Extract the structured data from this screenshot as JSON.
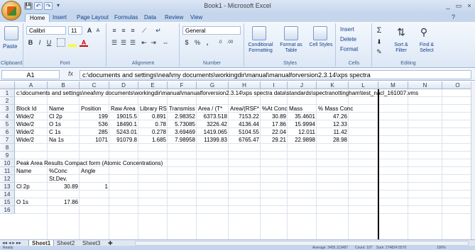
{
  "window": {
    "title": "Book1 - Microsoft Excel",
    "controls": [
      "_",
      "▭",
      "×"
    ]
  },
  "quick_access": [
    "💾",
    "↶",
    "↷",
    "▾"
  ],
  "tabs": [
    "Home",
    "Insert",
    "Page Layout",
    "Formulas",
    "Data",
    "Review",
    "View"
  ],
  "active_tab": "Home",
  "ribbon": {
    "clipboard": {
      "label": "Clipboard",
      "paste": "Paste"
    },
    "font": {
      "label": "Font",
      "family": "Calibri",
      "size": "11",
      "bold": "B",
      "italic": "I",
      "underline": "U",
      "grow": "A",
      "shrink": "A"
    },
    "alignment": {
      "label": "Alignment"
    },
    "number": {
      "label": "Number",
      "format": "General",
      "currency": "$",
      "percent": "%",
      "comma": ","
    },
    "styles": {
      "label": "Styles",
      "conditional": "Conditional Formatting",
      "format_table": "Format as Table",
      "cell_styles": "Cell Styles"
    },
    "cells": {
      "label": "Cells",
      "insert": "Insert",
      "delete": "Delete",
      "format": "Format"
    },
    "editing": {
      "label": "Editing",
      "sum": "Σ",
      "sort": "Sort & Filter",
      "find": "Find & Select"
    }
  },
  "formula_bar": {
    "name_box": "A1",
    "fx": "fx",
    "formula": "c:\\documents and settings\\neal\\my documents\\workingdir\\manual\\manualforversion2.3.14\\xps spectra"
  },
  "columns": [
    "A",
    "B",
    "C",
    "D",
    "E",
    "F",
    "G",
    "H",
    "I",
    "J",
    "K",
    "L",
    "M",
    "N",
    "O",
    "P"
  ],
  "rows": [
    "1",
    "2",
    "3",
    "4",
    "5",
    "6",
    "7",
    "8",
    "9",
    "10",
    "11",
    "12",
    "13",
    "14",
    "15",
    "16"
  ],
  "cells": {
    "r1": "c:\\documents and settings\\neal\\my documents\\workingdir\\manual\\manualforversion2.3.14\\xps spectra data\\standards\\spectranottingham\\test_nacl_161007.vms",
    "r3": [
      "Block Id",
      "Name",
      "Position",
      "Raw Area",
      "Library RS",
      "Transmiss",
      "Area / (T*",
      "Area/(RSF*",
      "%At Conc",
      "Mass",
      "% Mass Conc"
    ],
    "r4": [
      "Wide/2",
      "Cl 2p",
      "199",
      "19015.5",
      "0.891",
      "2.98352",
      "6373.518",
      "7153.22",
      "30.89",
      "35.4601",
      "47.26"
    ],
    "r5": [
      "Wide/2",
      "O 1s",
      "536",
      "18490.1",
      "0.78",
      "5.73085",
      "3226.42",
      "4136.44",
      "17.86",
      "15.9994",
      "12.33"
    ],
    "r6": [
      "Wide/2",
      "C 1s",
      "285",
      "5243.01",
      "0.278",
      "3.69469",
      "1419.065",
      "5104.55",
      "22.04",
      "12.011",
      "11.42"
    ],
    "r7": [
      "Wide/2",
      "Na 1s",
      "1071",
      "91079.8",
      "1.685",
      "7.98958",
      "11399.83",
      "6765.47",
      "29.21",
      "22.9898",
      "28.98"
    ],
    "r10": "Peak Area Results Compact form (Atomic Concentrations)",
    "r11": [
      "Name",
      "%Conc",
      "Angle"
    ],
    "r12": [
      "",
      "St.Dev."
    ],
    "r13": [
      "Cl 2p",
      "30.89",
      "1"
    ],
    "r15": [
      "O 1s",
      "17.86"
    ]
  },
  "sheets": [
    "Sheet1",
    "Sheet2",
    "Sheet3"
  ],
  "active_sheet": "Sheet1",
  "status": {
    "ready": "Ready",
    "average": "Average: 3455.113487",
    "count": "Count: 107",
    "sum": "Sum: 274824.5570",
    "zoom": "100%"
  }
}
